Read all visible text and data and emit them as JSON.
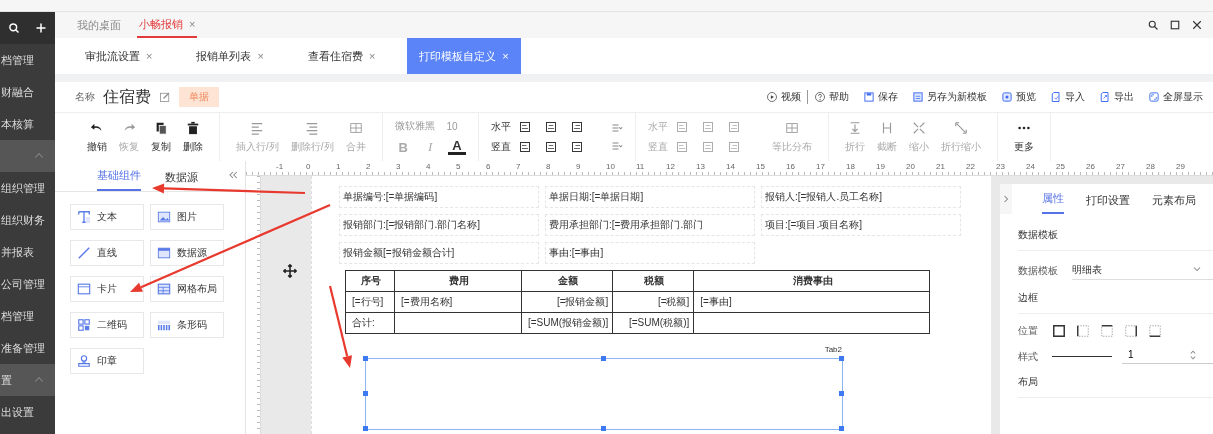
{
  "sidebar": {
    "items": [
      {
        "kind": "item",
        "label": "档管理"
      },
      {
        "kind": "item",
        "label": "财融合"
      },
      {
        "kind": "item",
        "label": "本核算"
      },
      {
        "kind": "section"
      },
      {
        "kind": "item",
        "label": "组织管理"
      },
      {
        "kind": "item",
        "label": "组织财务"
      },
      {
        "kind": "item",
        "label": "并报表"
      },
      {
        "kind": "item",
        "label": "公司管理"
      },
      {
        "kind": "item",
        "label": "档管理"
      },
      {
        "kind": "item",
        "label": "准备管理"
      },
      {
        "kind": "section",
        "label": "置"
      },
      {
        "kind": "item",
        "label": "出设置"
      }
    ]
  },
  "app_tabs": [
    {
      "label": "我的桌面",
      "selected": false
    },
    {
      "label": "小畅报销",
      "close": "×",
      "selected": true
    }
  ],
  "page_tabs": [
    {
      "label": "审批流设置",
      "close": "×",
      "selected": false
    },
    {
      "label": "报销单列表",
      "close": "×",
      "selected": false
    },
    {
      "label": "查看住宿费",
      "close": "×",
      "selected": false
    },
    {
      "label": "打印模板自定义",
      "close": "×",
      "selected": true
    }
  ],
  "header": {
    "name_label": "名称",
    "name": "住宿费",
    "tag": "单据",
    "actions": [
      {
        "kind": "play",
        "label": "视频"
      },
      {
        "kind": "help",
        "label": "帮助"
      },
      {
        "kind": "save",
        "label": "保存"
      },
      {
        "kind": "saveas",
        "label": "另存为新模板"
      },
      {
        "kind": "preview",
        "label": "预览"
      },
      {
        "kind": "import",
        "label": "导入"
      },
      {
        "kind": "export",
        "label": "导出"
      },
      {
        "kind": "fullscreen",
        "label": "全屏显示"
      }
    ]
  },
  "toolbar": [
    {
      "kind": "buttons",
      "buttons": [
        {
          "kind": "undo",
          "label": "撤销",
          "disabled": false
        },
        {
          "kind": "redo",
          "label": "恢复",
          "disabled": true
        },
        {
          "kind": "copy",
          "label": "复制",
          "disabled": false
        },
        {
          "kind": "delete",
          "label": "删除",
          "disabled": false
        }
      ]
    },
    {
      "kind": "buttons",
      "buttons": [
        {
          "kind": "insert",
          "label": "插入行/列",
          "disabled": true
        },
        {
          "kind": "remove",
          "label": "删除行/列",
          "disabled": true
        },
        {
          "kind": "merge",
          "label": "合并",
          "disabled": true
        }
      ]
    },
    {
      "kind": "font",
      "font": "微软雅黑",
      "size": "10",
      "styles": [
        {
          "kind": "bold",
          "label": "B",
          "disabled": true
        },
        {
          "kind": "italic",
          "label": "I",
          "disabled": true
        },
        {
          "kind": "color",
          "label": "A",
          "disabled": false
        }
      ]
    },
    {
      "kind": "align",
      "disabled": false,
      "rows": [
        {
          "label": "水平"
        },
        {
          "label": "竖直"
        }
      ],
      "extra": {
        "kind": "dropdowns"
      }
    },
    {
      "kind": "align",
      "disabled": true,
      "rows": [
        {
          "label": "水平"
        },
        {
          "label": "竖直"
        }
      ],
      "extra": {
        "kind": "button",
        "label": "等比分布"
      }
    },
    {
      "kind": "buttons",
      "buttons": [
        {
          "kind": "wrap",
          "label": "折行",
          "disabled": true
        },
        {
          "kind": "truncate",
          "label": "截断",
          "disabled": true
        },
        {
          "kind": "shrink",
          "label": "缩小",
          "disabled": true
        },
        {
          "kind": "wrapshrink",
          "label": "折行缩小",
          "disabled": true
        }
      ]
    },
    {
      "kind": "buttons",
      "buttons": [
        {
          "kind": "more",
          "label": "更多",
          "disabled": false
        }
      ]
    }
  ],
  "ruler": [
    "-1",
    "0",
    "1",
    "2",
    "3",
    "4",
    "5",
    "6",
    "7",
    "8",
    "9",
    "10",
    "11",
    "12",
    "13",
    "14",
    "15",
    "16",
    "17",
    "18",
    "19",
    "20",
    "21",
    "22",
    "23",
    "24",
    "25",
    "26",
    "27",
    "28",
    "29"
  ],
  "components_panel": {
    "tabs": [
      {
        "label": "基础组件",
        "selected": true
      },
      {
        "label": "数据源",
        "selected": false
      }
    ],
    "items": [
      {
        "kind": "text",
        "label": "文本"
      },
      {
        "kind": "image",
        "label": "图片"
      },
      {
        "kind": "line",
        "label": "直线"
      },
      {
        "kind": "datasource",
        "label": "数据源"
      },
      {
        "kind": "card",
        "label": "卡片"
      },
      {
        "kind": "grid",
        "label": "网格布局"
      },
      {
        "kind": "qrcode",
        "label": "二维码"
      },
      {
        "kind": "barcode",
        "label": "条形码"
      },
      {
        "kind": "stamp",
        "label": "印章"
      }
    ]
  },
  "document": {
    "fields": [
      {
        "label": "单据编号:",
        "value": "[=单据编码]"
      },
      {
        "label": "单据日期:",
        "value": "[=单据日期]"
      },
      {
        "label": "报销人:",
        "value": "[=报销人.员工名称]"
      },
      {
        "label": "报销部门:",
        "value": "[=报销部门.部门名称]"
      },
      {
        "label": "费用承担部门:",
        "value": "[=费用承担部门.部门"
      },
      {
        "label": "项目:",
        "value": "[=项目.项目名称]"
      },
      {
        "label": "报销金额",
        "value": "[=报销金额合计]"
      },
      {
        "label": "事由:",
        "value": "[=事由]"
      }
    ],
    "table": {
      "columns": [
        "序号",
        "费用",
        "金额",
        "税额",
        "消费事由"
      ],
      "rows": [
        [
          "[=行号]",
          "[=费用名称]",
          "[=报销金额]",
          "[=税额]",
          "[=事由]"
        ],
        [
          "合计:",
          "",
          "[=SUM(报销金额)]",
          "[=SUM(税额)]",
          ""
        ]
      ]
    },
    "selection_label": "Tab2"
  },
  "properties_panel": {
    "tabs": [
      {
        "label": "属性",
        "selected": true
      },
      {
        "label": "打印设置",
        "selected": false
      },
      {
        "label": "元素布局",
        "selected": false
      }
    ],
    "sections": [
      {
        "title": "数据模板",
        "rows": [
          {
            "kind": "select",
            "label": "数据模板",
            "value": "明细表"
          }
        ]
      },
      {
        "title": "边框",
        "rows": [
          {
            "kind": "border_positions",
            "label": "位置"
          },
          {
            "kind": "line_style",
            "label": "样式",
            "value": "1"
          }
        ]
      },
      {
        "title": "布局"
      }
    ]
  }
}
